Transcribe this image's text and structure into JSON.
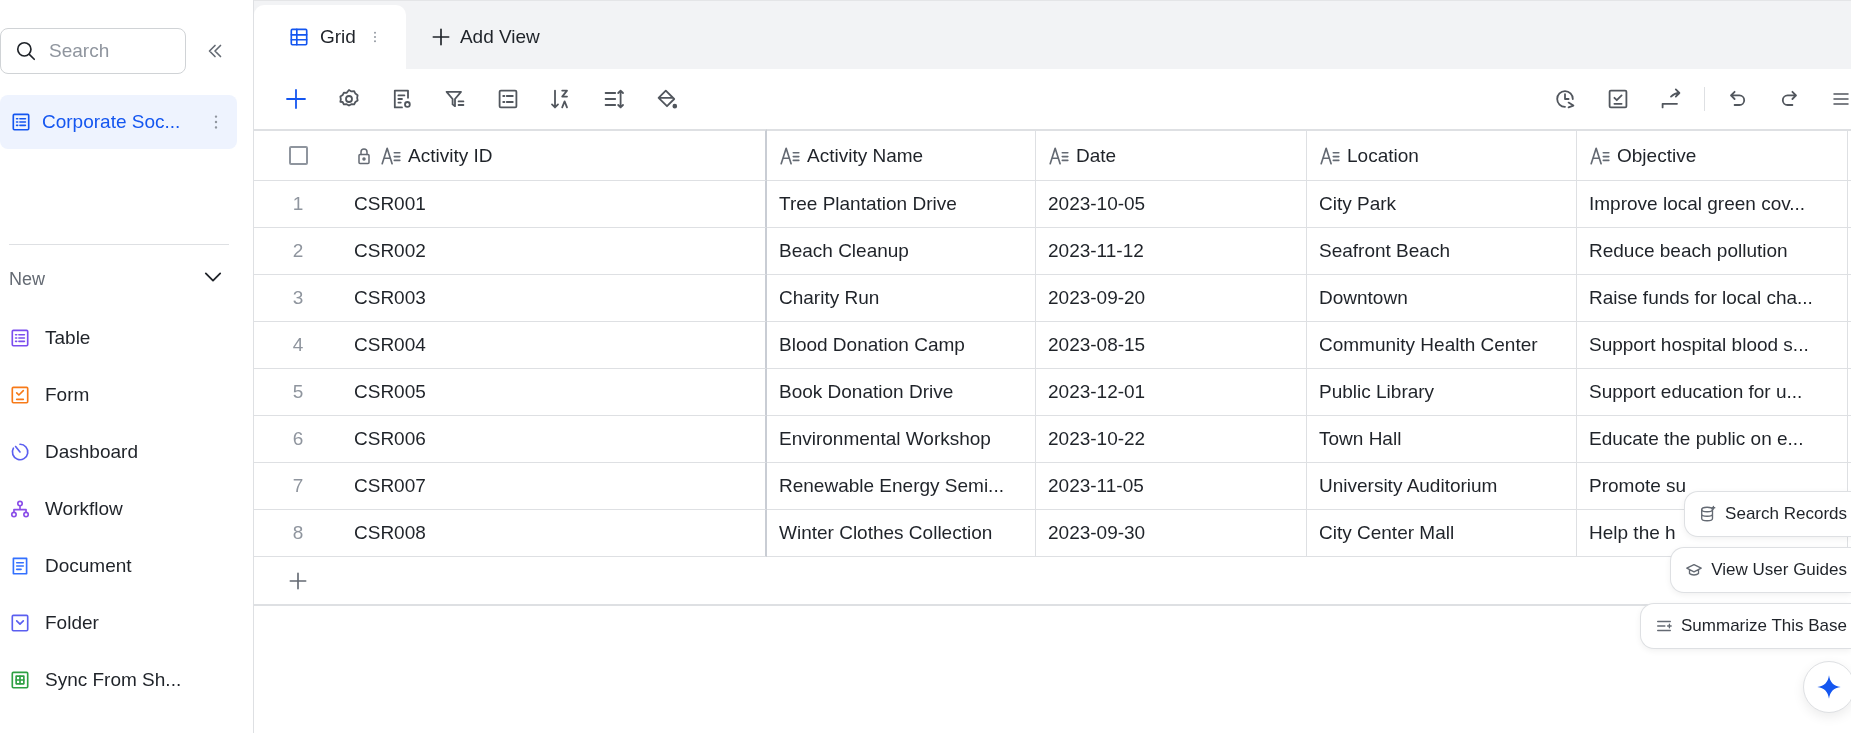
{
  "sidebar": {
    "search": {
      "placeholder": "Search"
    },
    "bases": [
      {
        "label": "Corporate Soc...",
        "selected": true
      }
    ],
    "section": {
      "label": "New",
      "expanded": true
    },
    "items": [
      {
        "label": "Table",
        "kind": "table",
        "color": "#7b4dee"
      },
      {
        "label": "Form",
        "kind": "form",
        "color": "#f77a18"
      },
      {
        "label": "Dashboard",
        "kind": "dashboard",
        "color": "#5b5ff0"
      },
      {
        "label": "Workflow",
        "kind": "workflow",
        "color": "#8a4ee8"
      },
      {
        "label": "Document",
        "kind": "document",
        "color": "#3370ff"
      },
      {
        "label": "Folder",
        "kind": "folder",
        "color": "#5b5ff0"
      },
      {
        "label": "Sync From Sh...",
        "kind": "sync",
        "color": "#2ea043"
      }
    ]
  },
  "tabs": [
    {
      "label": "Grid",
      "selected": true
    }
  ],
  "add_view": "Add View",
  "table": {
    "select_all": {
      "checked": false
    },
    "columns": [
      "Activity ID",
      "Activity Name",
      "Date",
      "Location",
      "Objective"
    ],
    "rows": [
      {
        "number": "1",
        "cells": [
          "CSR001",
          "Tree Plantation Drive",
          "2023-10-05",
          "City Park",
          "Improve local green cov..."
        ]
      },
      {
        "number": "2",
        "cells": [
          "CSR002",
          "Beach Cleanup",
          "2023-11-12",
          "Seafront Beach",
          "Reduce beach pollution"
        ]
      },
      {
        "number": "3",
        "cells": [
          "CSR003",
          "Charity Run",
          "2023-09-20",
          "Downtown",
          "Raise funds for local cha..."
        ]
      },
      {
        "number": "4",
        "cells": [
          "CSR004",
          "Blood Donation Camp",
          "2023-08-15",
          "Community Health Center",
          "Support hospital blood s..."
        ]
      },
      {
        "number": "5",
        "cells": [
          "CSR005",
          "Book Donation Drive",
          "2023-12-01",
          "Public Library",
          "Support education for u..."
        ]
      },
      {
        "number": "6",
        "cells": [
          "CSR006",
          "Environmental Workshop",
          "2023-10-22",
          "Town Hall",
          "Educate the public on e..."
        ]
      },
      {
        "number": "7",
        "cells": [
          "CSR007",
          "Renewable Energy Semi...",
          "2023-11-05",
          "University Auditorium",
          "Promote su"
        ]
      },
      {
        "number": "8",
        "cells": [
          "CSR008",
          "Winter Clothes Collection",
          "2023-09-30",
          "City Center Mall",
          "Help the h"
        ]
      }
    ]
  },
  "ai_actions": [
    {
      "label": "Search Records",
      "kind": "database"
    },
    {
      "label": "View User Guides",
      "kind": "guide"
    },
    {
      "label": "Summarize This Base",
      "kind": "summary"
    }
  ]
}
